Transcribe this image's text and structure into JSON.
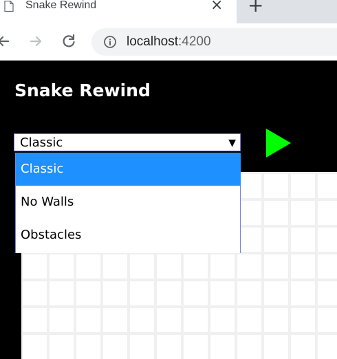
{
  "browser": {
    "tab_title": "Snake Rewind",
    "close_icon": "×",
    "new_tab_icon": "+",
    "url_host": "localhost",
    "url_port": ":4200"
  },
  "app": {
    "title": "Snake Rewind"
  },
  "mode_select": {
    "selected": "Classic",
    "arrow": "▼",
    "options": [
      "Classic",
      "No Walls",
      "Obstacles"
    ]
  },
  "colors": {
    "play_button": "#00ff00",
    "highlight": "#1e90ff",
    "board_grid": "#f0f0f0"
  },
  "icons": [
    "page-icon",
    "close-icon",
    "plus-icon",
    "back-icon",
    "forward-icon",
    "reload-icon",
    "info-icon",
    "dropdown-arrow-icon",
    "play-icon"
  ]
}
